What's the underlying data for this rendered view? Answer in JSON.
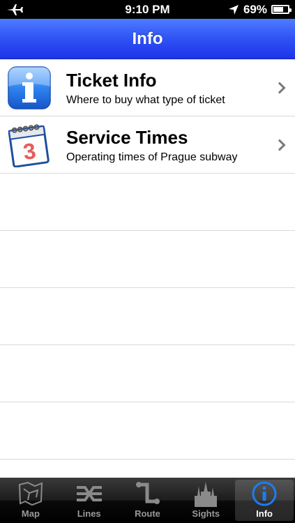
{
  "status_bar": {
    "time": "9:10 PM",
    "battery": "69%",
    "battery_level": 0.69
  },
  "nav": {
    "title": "Info"
  },
  "rows": [
    {
      "title": "Ticket Info",
      "subtitle": "Where to buy what type of ticket",
      "icon": "info-icon"
    },
    {
      "title": "Service Times",
      "subtitle": "Operating times of Prague subway",
      "icon": "calendar-icon",
      "calendar_number": "3"
    }
  ],
  "tabs": [
    {
      "label": "Map",
      "icon": "map-icon"
    },
    {
      "label": "Lines",
      "icon": "lines-icon"
    },
    {
      "label": "Route",
      "icon": "route-icon"
    },
    {
      "label": "Sights",
      "icon": "sights-icon"
    },
    {
      "label": "Info",
      "icon": "info-icon",
      "selected": true
    }
  ],
  "colors": {
    "nav_blue": "#2f52f5",
    "tab_selected_blue": "#1e7cf0"
  }
}
